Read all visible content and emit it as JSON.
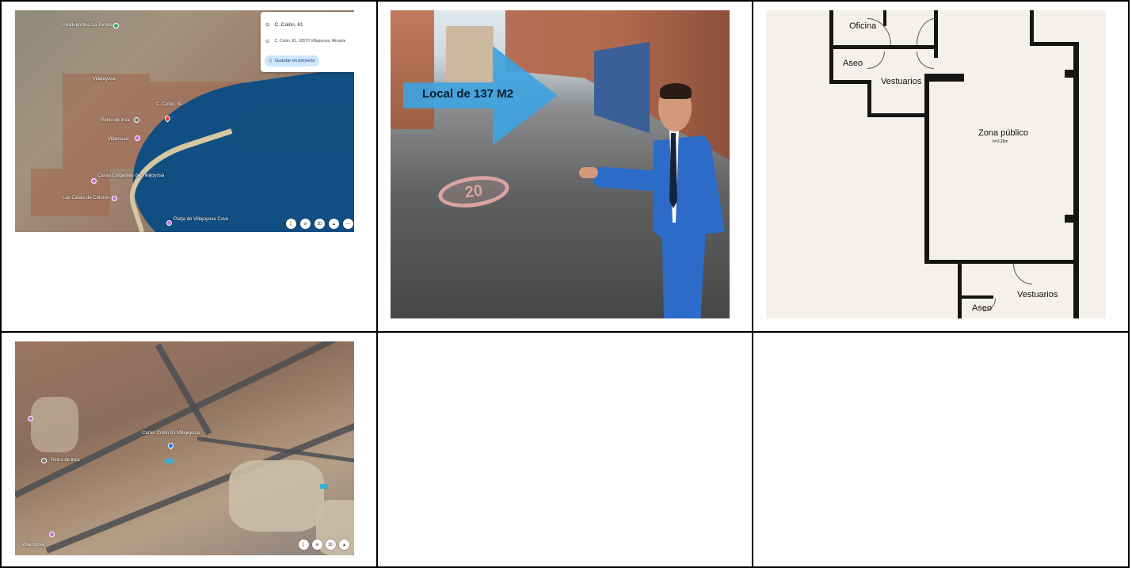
{
  "map1": {
    "panel": {
      "place_title": "C. Colón, 81",
      "address": "C. Colón, 81, 03570 Villajoyosa, Alicante",
      "save_button": "Guardar en proyecto"
    },
    "labels": {
      "poi_top": "Polideportivo La Torreta",
      "villajoyosa": "Villajoyosa",
      "pin_address": "C. Colón, 81",
      "reino": "Reino de inca",
      "villamusic": "Villamusic",
      "casas_colgantes": "Casas Colgantes de Villajoyosa",
      "casas_colores": "Las Casas de Colores",
      "beach": "Platja de Villajoyosa Cove"
    },
    "controls": [
      "🚶",
      "⊘",
      "3D",
      "▲",
      "—"
    ]
  },
  "street": {
    "arrow_text": "Local de 137 M2",
    "road_sign": "20"
  },
  "plan": {
    "oficina": "Oficina",
    "aseo_top": "Aseo",
    "vestuarios_top": "Vestuarios",
    "zona_publico": "Zona público",
    "height_note": "h=3.26m",
    "vestuarios_bottom": "Vestuarios",
    "aseo_bottom": "Aseo"
  },
  "map2": {
    "labels": {
      "pin_address": "Carrer Colón 81 Villajoyosa",
      "reino": "Reino de inca",
      "villajoyosa": "Villajoyosa"
    },
    "controls": [
      "🚶",
      "⊘",
      "3D",
      "▲"
    ]
  },
  "colors": {
    "border": "#000000",
    "arrow": "#3fa3e0",
    "sea": "#114f82",
    "save_button_bg": "#cfe5fb"
  }
}
